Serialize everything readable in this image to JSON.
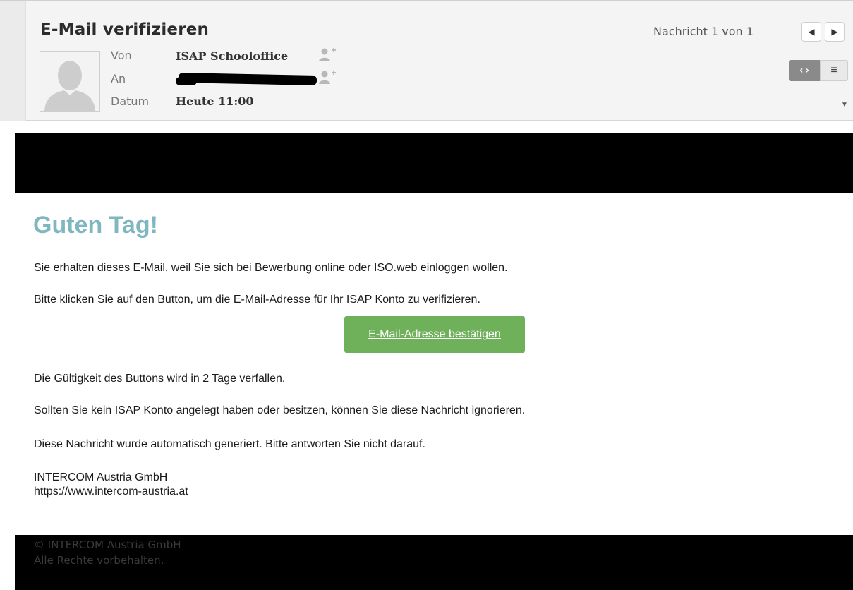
{
  "header": {
    "subject": "E-Mail verifizieren",
    "from_label": "Von",
    "from_value": "ISAP Schooloffice",
    "to_label": "An",
    "date_label": "Datum",
    "date_value": "Heute 11:00",
    "message_count": "Nachricht 1 von 1",
    "prev_icon": "◀",
    "next_icon": "▶",
    "html_view_icon": "‹›",
    "text_view_icon": "≡",
    "expand_icon": "▼"
  },
  "email": {
    "greeting": "Guten Tag!",
    "p1": "Sie erhalten dieses E-Mail, weil Sie sich bei Bewerbung online oder ISO.web einloggen wollen.",
    "p2": "Bitte klicken Sie auf den Button, um die E-Mail-Adresse für Ihr ISAP Konto zu verifizieren.",
    "button": "E-Mail-Adresse bestätigen",
    "p3": "Die Gültigkeit des Buttons wird in 2 Tage verfallen.",
    "p4": "Sollten Sie kein ISAP Konto angelegt haben oder besitzen, können Sie diese Nachricht ignorieren.",
    "p5": "Diese Nachricht wurde automatisch generiert. Bitte antworten Sie nicht darauf.",
    "company": "INTERCOM Austria GmbH",
    "url": "https://www.intercom-austria.at"
  },
  "footer": {
    "copyright": "© INTERCOM Austria GmbH",
    "rights": "Alle Rechte vorbehalten."
  },
  "colors": {
    "greeting": "#7fb7c0",
    "button": "#6fb15b",
    "banner": "#000000"
  }
}
